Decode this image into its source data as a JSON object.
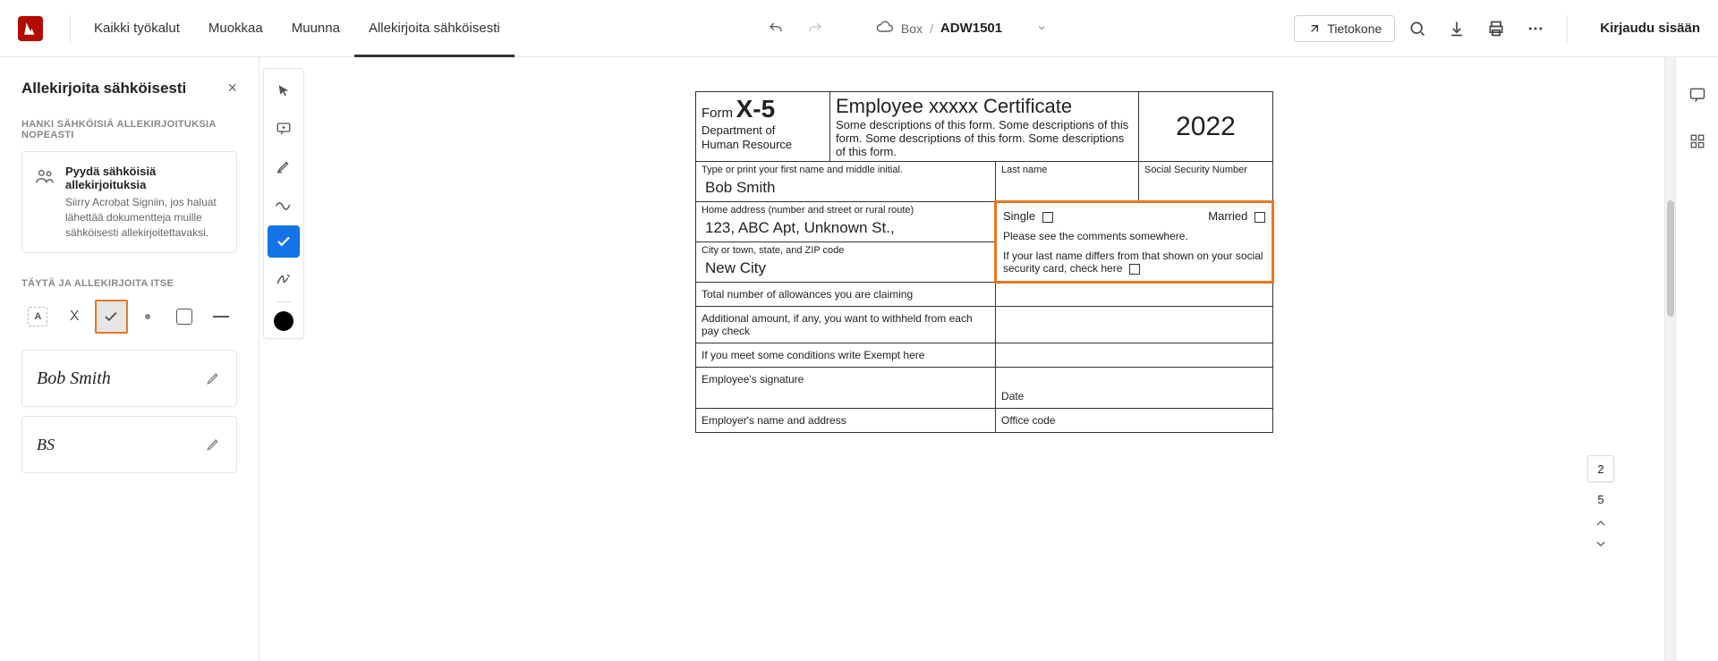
{
  "topbar": {
    "menu": {
      "tools": "Kaikki työkalut",
      "edit": "Muokkaa",
      "convert": "Muunna",
      "sign": "Allekirjoita sähköisesti"
    },
    "breadcrumb": {
      "box": "Box",
      "sep": "/",
      "file": "ADW1501"
    },
    "device_label": "Tietokone",
    "login": "Kirjaudu sisään"
  },
  "left": {
    "title": "Allekirjoita sähköisesti",
    "section_get": "HANKI SÄHKÖISIÄ ALLEKIRJOITUKSIA NOPEASTI",
    "card_title": "Pyydä sähköisiä allekirjoituksia",
    "card_desc": "Siirry Acrobat Signiin, jos haluat lähettää dokumentteja muille sähköisesti allekirjoitettavaksi.",
    "section_fill": "TÄYTÄ JA ALLEKIRJOITA ITSE",
    "tool_text": "A",
    "tool_x": "X",
    "sig1": "Bob Smith",
    "sig2": "BS"
  },
  "doc": {
    "form_label": "Form",
    "form_num": "X-5",
    "dept1": "Department of",
    "dept2": "Human Resource",
    "title": "Employee xxxxx Certificate",
    "desc": "Some descriptions of this form. Some descriptions of this form. Some descriptions of this form. Some descriptions of this form.",
    "year": "2022",
    "lbl_first": "Type or print your first name and middle initial.",
    "val_first": "Bob Smith",
    "lbl_last": "Last name",
    "lbl_ssn": "Social Security Number",
    "lbl_addr": "Home address (number and street or rural route)",
    "val_addr": "123, ABC Apt, Unknown St.,",
    "single": "Single",
    "married": "Married",
    "note1": "Please see the comments somewhere.",
    "note2a": "If your last name differs from that shown on your social security card, check here",
    "lbl_city": "City or town, state, and ZIP code",
    "val_city": "New City",
    "row_allow": "Total number of allowances you are claiming",
    "row_addl": "Additional amount, if any, you want to withheld from each pay check",
    "row_exempt": "If you meet some conditions write Exempt here",
    "row_empsig": "Employee's signature",
    "row_date": "Date",
    "row_employer": "Employer's name and address",
    "row_office": "Office code"
  },
  "nav": {
    "current": "2",
    "total": "5"
  }
}
